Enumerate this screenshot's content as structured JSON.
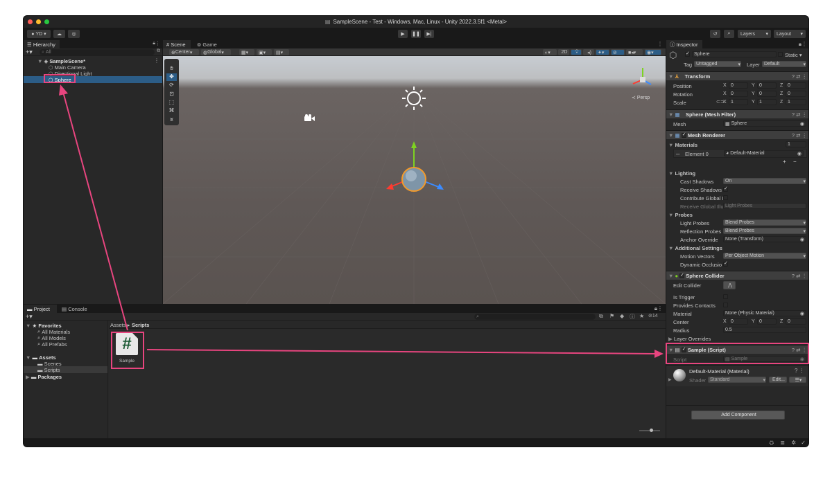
{
  "window": {
    "title": "SampleScene - Test - Windows, Mac, Linux - Unity 2022.3.5f1 <Metal>"
  },
  "toolbar": {
    "account": "YD",
    "layers": "Layers",
    "layout": "Layout"
  },
  "hierarchy": {
    "tab": "Hierarchy",
    "search_placeholder": "All",
    "scene": "SampleScene*",
    "items": [
      "Main Camera",
      "Directional Light",
      "Sphere"
    ]
  },
  "scene_view": {
    "tabs": [
      "Scene",
      "Game"
    ],
    "pivot": "Center",
    "space": "Global",
    "mode_2d": "2D",
    "persp": "Persp"
  },
  "project": {
    "tabs": [
      "Project",
      "Console"
    ],
    "favorites_label": "Favorites",
    "favorites": [
      "All Materials",
      "All Models",
      "All Prefabs"
    ],
    "assets_label": "Assets",
    "assets": [
      "Scenes",
      "Scripts"
    ],
    "packages_label": "Packages",
    "breadcrumb_root": "Assets",
    "breadcrumb_current": "Scripts",
    "file_name": "Sample",
    "file_icon": "#",
    "hidden_count": "14"
  },
  "inspector": {
    "tab": "Inspector",
    "object_name": "Sphere",
    "static_label": "Static",
    "tag_label": "Tag",
    "tag_value": "Untagged",
    "layer_label": "Layer",
    "layer_value": "Default",
    "transform": {
      "title": "Transform",
      "position": "Position",
      "rotation": "Rotation",
      "scale": "Scale",
      "pos": [
        "0",
        "0",
        "0"
      ],
      "rot": [
        "0",
        "0",
        "0"
      ],
      "scl": [
        "1",
        "1",
        "1"
      ]
    },
    "mesh_filter": {
      "title": "Sphere (Mesh Filter)",
      "mesh_label": "Mesh",
      "mesh_value": "Sphere"
    },
    "mesh_renderer": {
      "title": "Mesh Renderer",
      "materials_label": "Materials",
      "materials_count": "1",
      "element0_label": "Element 0",
      "element0_value": "Default-Material",
      "lighting_label": "Lighting",
      "cast_shadows_label": "Cast Shadows",
      "cast_shadows_value": "On",
      "receive_shadows_label": "Receive Shadows",
      "contribute_gi_label": "Contribute Global I",
      "receive_gi_label": "Receive Global Illu",
      "receive_gi_value": "Light Probes",
      "probes_label": "Probes",
      "light_probes_label": "Light Probes",
      "light_probes_value": "Blend Probes",
      "reflection_probes_label": "Reflection Probes",
      "reflection_probes_value": "Blend Probes",
      "anchor_label": "Anchor Override",
      "anchor_value": "None (Transform)",
      "additional_label": "Additional Settings",
      "motion_label": "Motion Vectors",
      "motion_value": "Per Object Motion",
      "dynamic_label": "Dynamic Occlusio"
    },
    "sphere_collider": {
      "title": "Sphere Collider",
      "edit_label": "Edit Collider",
      "trigger_label": "Is Trigger",
      "contacts_label": "Provides Contacts",
      "material_label": "Material",
      "material_value": "None (Physic Material)",
      "center_label": "Center",
      "center": [
        "0",
        "0",
        "0"
      ],
      "radius_label": "Radius",
      "radius_value": "0.5",
      "overrides_label": "Layer Overrides"
    },
    "script": {
      "title": "Sample (Script)",
      "script_label": "Script",
      "script_value": "Sample"
    },
    "material": {
      "title": "Default-Material (Material)",
      "shader_label": "Shader",
      "shader_value": "Standard",
      "edit_label": "Edit..."
    },
    "add_component": "Add Component"
  },
  "colors": {
    "accent": "#e8457f",
    "selection": "#2c5d87",
    "panel": "#282828"
  }
}
